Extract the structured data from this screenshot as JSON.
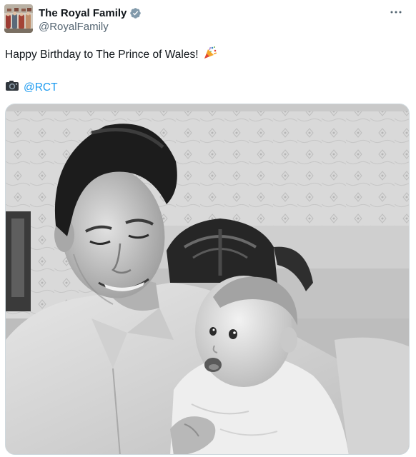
{
  "post": {
    "author": {
      "display_name": "The Royal Family",
      "handle": "@RoyalFamily",
      "verified": true,
      "verified_color": "#829aab"
    },
    "text": "Happy Birthday to The Prince of Wales!",
    "text_emoji": "party-popper-icon",
    "credit": {
      "icon": "camera-icon",
      "mention": "@RCT"
    },
    "more_icon": "more-options-icon",
    "media": {
      "kind": "black-and-white photograph",
      "subject": "man holding smiling baby"
    }
  },
  "colors": {
    "text": "#0f1419",
    "secondary": "#536471",
    "link": "#1d9bf0"
  }
}
